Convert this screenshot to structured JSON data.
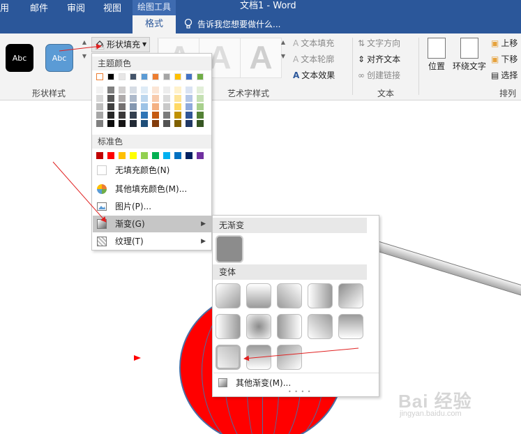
{
  "window": {
    "context_tab_label": "绘图工具",
    "title": "文档1 - Word"
  },
  "tabs": [
    {
      "label": "用"
    },
    {
      "label": "邮件"
    },
    {
      "label": "审阅"
    },
    {
      "label": "视图"
    },
    {
      "label": "格式",
      "active": true
    }
  ],
  "tell_me": "告诉我您想要做什么...",
  "ribbon": {
    "shape_styles": {
      "swatch_1_text": "Abc",
      "swatch_2_text": "Abc",
      "shape_fill_label": "形状填充",
      "group_label": "形状样式"
    },
    "art_styles": {
      "letter": "A",
      "text_fill": "文本填充",
      "text_outline": "文本轮廓",
      "text_effects": "文本效果",
      "group_label": "艺术字样式"
    },
    "text_group": {
      "text_direction": "文字方向",
      "align_text": "对齐文本",
      "create_link": "创建链接",
      "group_label": "文本"
    },
    "arrange": {
      "position": "位置",
      "wrap_text": "环绕文字",
      "bring_forward": "上移",
      "send_backward": "下移",
      "selection_pane": "选择",
      "group_label": "排列"
    }
  },
  "fill_menu": {
    "theme_colors_title": "主题颜色",
    "theme_colors": [
      "#ffffff",
      "#000000",
      "#e7e6e6",
      "#44546a",
      "#5b9bd5",
      "#ed7d31",
      "#a5a5a5",
      "#ffc000",
      "#4472c4",
      "#70ad47"
    ],
    "theme_tints": [
      [
        "#f2f2f2",
        "#d9d9d9",
        "#bfbfbf",
        "#a6a6a6",
        "#808080"
      ],
      [
        "#808080",
        "#595959",
        "#404040",
        "#262626",
        "#0d0d0d"
      ],
      [
        "#d0cece",
        "#aeaaaa",
        "#757171",
        "#3a3838",
        "#171616"
      ],
      [
        "#d6dce4",
        "#adb9ca",
        "#8497b0",
        "#333f4f",
        "#222a35"
      ],
      [
        "#deebf6",
        "#bdd7ee",
        "#9dc3e6",
        "#2e75b6",
        "#1f4e79"
      ],
      [
        "#fbe5d5",
        "#f8cbad",
        "#f4b183",
        "#c55a11",
        "#833c0b"
      ],
      [
        "#ededed",
        "#dbdbdb",
        "#c9c9c9",
        "#7b7b7b",
        "#525252"
      ],
      [
        "#fff2cc",
        "#fee599",
        "#ffd965",
        "#bf9000",
        "#7f6000"
      ],
      [
        "#dae3f3",
        "#b4c7e7",
        "#8faadc",
        "#2f5597",
        "#203864"
      ],
      [
        "#e2efd9",
        "#c5e0b3",
        "#a8d08d",
        "#538135",
        "#375623"
      ]
    ],
    "standard_colors_title": "标准色",
    "standard_colors": [
      "#c00000",
      "#ff0000",
      "#ffc000",
      "#ffff00",
      "#92d050",
      "#00b050",
      "#00b0f0",
      "#0070c0",
      "#002060",
      "#7030a0"
    ],
    "no_fill": "无填充颜色(N)",
    "more_colors": "其他填充颜色(M)...",
    "picture": "图片(P)...",
    "gradient": "渐变(G)",
    "texture": "纹理(T)"
  },
  "gradient_menu": {
    "no_gradient_title": "无渐变",
    "variants_title": "变体",
    "more_gradients": "其他渐变(M)..."
  },
  "watermark": {
    "logo": "Bai 经验",
    "url": "jingyan.baidu.com"
  }
}
